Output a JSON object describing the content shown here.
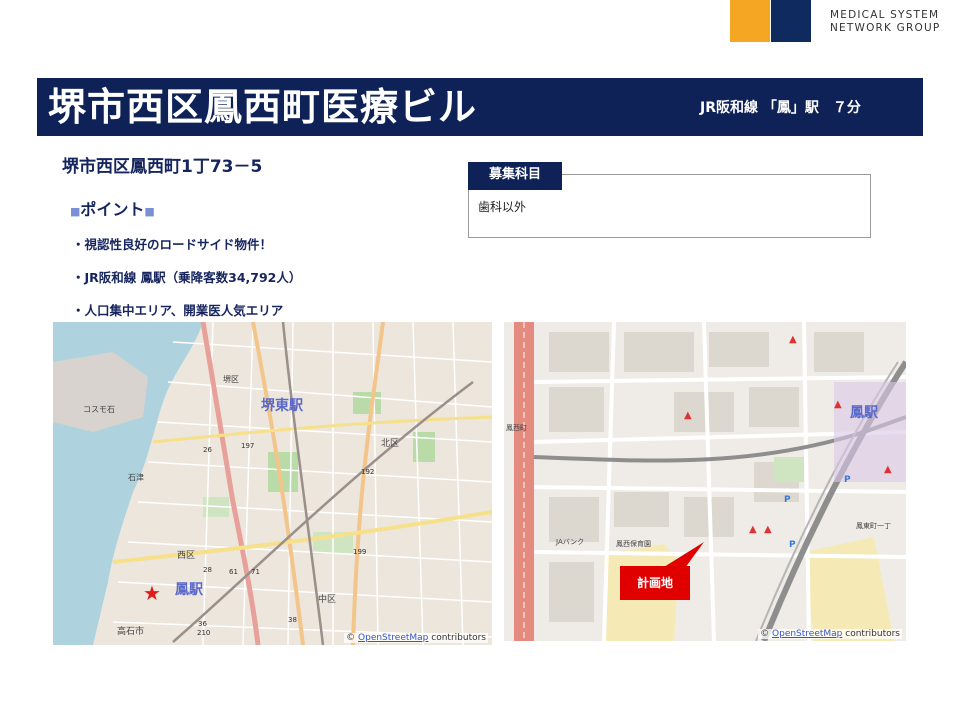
{
  "brand": {
    "line1": "MEDICAL SYSTEM",
    "line2": "NETWORK GROUP",
    "colors": {
      "orange": "#f5a623",
      "navy": "#0f2a5e"
    }
  },
  "header": {
    "title": "堺市西区鳳西町医療ビル",
    "station": "JR阪和線 「鳳」駅　７分"
  },
  "address": "堺市西区鳳西町1丁73－5",
  "points": {
    "heading": "ポイント",
    "items": [
      "・視認性良好のロードサイド物件！",
      "・JR阪和線 鳳駅（乗降客数34,792人）",
      "・人口集中エリア、開業医人気エリア"
    ]
  },
  "recruit": {
    "label": "募集科目",
    "value": "歯科以外"
  },
  "maps": {
    "wide": {
      "labels": {
        "sakai_higashi": "堺東駅",
        "otori": "鳳駅",
        "nishi_ku": "西区",
        "kita_ku": "北区",
        "naka_ku": "中区",
        "takaishi": "高石市",
        "ishizu": "石津",
        "sakai_ku": "堺区",
        "cosmo": "コスモ石"
      },
      "road_numbers": [
        "197",
        "26",
        "192",
        "199",
        "28",
        "61",
        "71",
        "36",
        "210",
        "38"
      ],
      "attribution_symbol": "©",
      "attribution_link": "OpenStreetMap",
      "attribution_suffix": " contributors"
    },
    "detail": {
      "labels": {
        "otori_station": "鳳駅",
        "site": "計画地",
        "otori_nishimachi": "鳳西町",
        "otori_higashimachi": "鳳東町一丁",
        "ja_bank": "JAバンク",
        "otori_school": "鳳西保育園"
      },
      "attribution_symbol": "©",
      "attribution_link": "OpenStreetMap",
      "attribution_suffix": " contributors"
    }
  }
}
